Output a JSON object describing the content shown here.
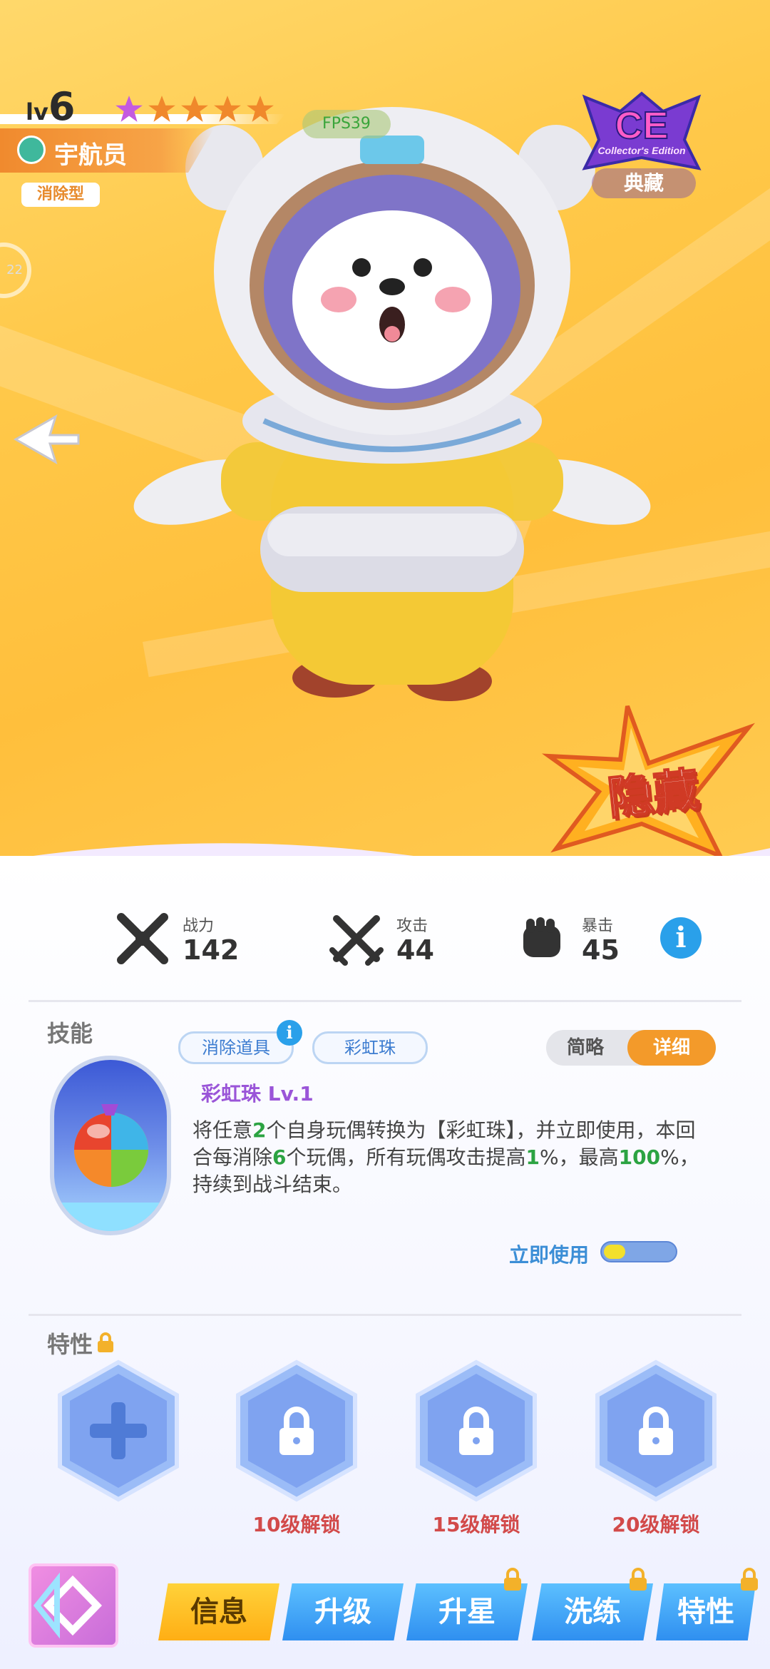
{
  "header": {
    "lv_prefix": "lv",
    "level": "6",
    "stars_total": 5,
    "role_name": "宇航员",
    "type_tag": "消除型",
    "fps": "FPS39",
    "side_badge": "22",
    "edition_logo": "CE",
    "edition_subtitle": "Collector's Edition",
    "collection_tag": "典藏",
    "rarity_label": "隐藏"
  },
  "stats": [
    {
      "label": "战力",
      "value": "142",
      "icon": "swords-icon"
    },
    {
      "label": "攻击",
      "value": "44",
      "icon": "crossed-swords-icon"
    },
    {
      "label": "暴击",
      "value": "45",
      "icon": "fist-icon"
    }
  ],
  "stats_info": "i",
  "skill": {
    "section_title": "技能",
    "chips": [
      "消除道具",
      "彩虹珠"
    ],
    "chip_info": "i",
    "toggle": {
      "brief": "简略",
      "detail": "详细",
      "selected": "详细"
    },
    "name": "彩虹珠 Lv.1",
    "desc_parts": [
      {
        "t": "将任意",
        "g": false
      },
      {
        "t": "2",
        "g": true
      },
      {
        "t": "个自身玩偶转换为【彩虹珠】，并立即使用，本回合每消除",
        "g": false
      },
      {
        "t": "6",
        "g": true
      },
      {
        "t": "个玩偶，所有玩偶攻击提高",
        "g": false
      },
      {
        "t": "1",
        "g": true
      },
      {
        "t": "%，最高",
        "g": false
      },
      {
        "t": "100",
        "g": true
      },
      {
        "t": "%，持续到战斗结束。",
        "g": false
      }
    ],
    "use_label": "立即使用",
    "use_progress": 0.3
  },
  "traits": {
    "section_title": "特性",
    "slots": [
      {
        "kind": "add",
        "unlock": ""
      },
      {
        "kind": "locked",
        "unlock": "10级解锁"
      },
      {
        "kind": "locked",
        "unlock": "15级解锁"
      },
      {
        "kind": "locked",
        "unlock": "20级解锁"
      }
    ]
  },
  "bottom_nav": {
    "tabs": [
      {
        "label": "信息",
        "active": true,
        "locked": false
      },
      {
        "label": "升级",
        "active": false,
        "locked": false
      },
      {
        "label": "升星",
        "active": false,
        "locked": true
      },
      {
        "label": "洗练",
        "active": false,
        "locked": true
      },
      {
        "label": "特性",
        "active": false,
        "locked": true
      }
    ]
  },
  "colors": {
    "bg_yellow": "#ffc94a",
    "accent_orange": "#f39a2a",
    "tab_blue": "#3aa3f0",
    "tab_active": "#ffc21a",
    "highlight_green": "#2ca342"
  }
}
